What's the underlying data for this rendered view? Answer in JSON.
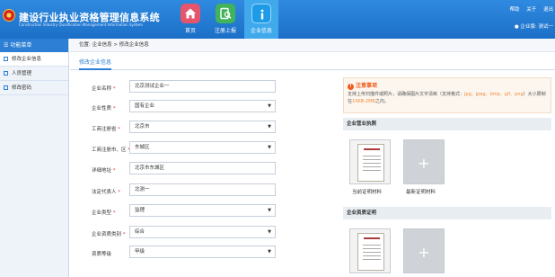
{
  "header": {
    "title": "建设行业执业资格管理信息系统",
    "subtitle": "Construction Industry Qualification Management Information System",
    "nav": [
      {
        "label": "首页",
        "icon": "home-icon"
      },
      {
        "label": "注册上报",
        "icon": "register-icon"
      },
      {
        "label": "企业信息",
        "icon": "info-icon"
      }
    ],
    "links": [
      "帮助",
      "关于",
      "退出"
    ],
    "user": "企业版: 测试一"
  },
  "sidebar": {
    "heading": "功能菜单",
    "items": [
      {
        "label": "修改企业信息"
      },
      {
        "label": "人员管理"
      },
      {
        "label": "修改密码"
      }
    ]
  },
  "breadcrumb": {
    "label": "位置:",
    "path": "企业信息 > 修改企业信息"
  },
  "tab": "修改企业信息",
  "form": {
    "fields": [
      {
        "label": "企业名称",
        "value": "北京测试企业一",
        "type": "text"
      },
      {
        "label": "企业性质",
        "value": "国有企业",
        "type": "select"
      },
      {
        "label": "工商注册省",
        "value": "北京市",
        "type": "select"
      },
      {
        "label": "工商注册市、区",
        "value": "东城区",
        "type": "select"
      },
      {
        "label": "详细地址",
        "value": "北京市东城区",
        "type": "text"
      },
      {
        "label": "法定代表人",
        "value": "北测一",
        "type": "text"
      },
      {
        "label": "企业类型",
        "value": "监理",
        "type": "select"
      },
      {
        "label": "企业资质类别",
        "value": "综合",
        "type": "select"
      },
      {
        "label": "资质等级",
        "value": "甲级",
        "type": "select"
      }
    ]
  },
  "notice": {
    "title": "注意事项",
    "line1": "支持上传扫描件或照片，请确保图片文字清晰（支持格式：",
    "formats": "jpg、jpeg、bmp、gif、png",
    "line2": "）大小限制在",
    "limit": "10KB-2MB",
    "line3": "之内。"
  },
  "license": {
    "heading": "企业营业执照",
    "current_caption": "当前证明材料",
    "new_caption": "最新证明材料"
  },
  "qualification": {
    "heading": "企业资质证明"
  }
}
